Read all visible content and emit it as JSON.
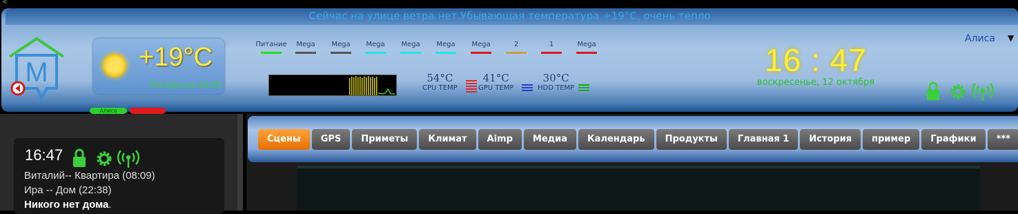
{
  "ticker": "Сейчас на улице ветра нет.Убывающая температура +19°C, очень тепло",
  "weather": {
    "temp": "+19°C",
    "subtitle": "Погода на 16:00"
  },
  "pills": {
    "green": "Алиса",
    "red": ""
  },
  "sensors": [
    {
      "label": "Питание",
      "color": "#22dd22"
    },
    {
      "label": "Mega",
      "color": "#555555"
    },
    {
      "label": "Mega",
      "color": "#555555"
    },
    {
      "label": "Mega",
      "color": "#22e5e5"
    },
    {
      "label": "Mega",
      "color": "#22e5e5"
    },
    {
      "label": "Mega",
      "color": "#22e5e5"
    },
    {
      "label": "Mega",
      "color": "#dd1a1a"
    },
    {
      "label": "2",
      "color": "#c8a040"
    },
    {
      "label": "1",
      "color": "#dd1a1a"
    },
    {
      "label": "Mega",
      "color": "#dd1a1a"
    }
  ],
  "temps": [
    {
      "value": "54°C",
      "label": "CPU TEMP",
      "color": "#e02a2a"
    },
    {
      "value": "41°C",
      "label": "GPU TEMP",
      "color": "#2a3ec8"
    },
    {
      "value": "30°C",
      "label": "HDD TEMP",
      "color": "#22aa22"
    }
  ],
  "clock": {
    "time": "16 : 47",
    "date": "воскресенье,  12 октября"
  },
  "user": {
    "name": "Алиса"
  },
  "card": {
    "time": "16:47",
    "line1": "Виталий-- Квартира (08:09)",
    "line2": "Ира -- Дом (22:38)",
    "line3": "Никого нет дома",
    "line3_suffix": "."
  },
  "tabs": [
    "Сцены",
    "GPS",
    "Приметы",
    "Климат",
    "Aimp",
    "Медиа",
    "Календарь",
    "Продукты",
    "Главная 1",
    "История",
    "пример",
    "Графики",
    "***"
  ],
  "colors": {
    "accent": "#e56f00",
    "status_green": "#2cd02c",
    "clock_yellow": "#ffee33"
  }
}
